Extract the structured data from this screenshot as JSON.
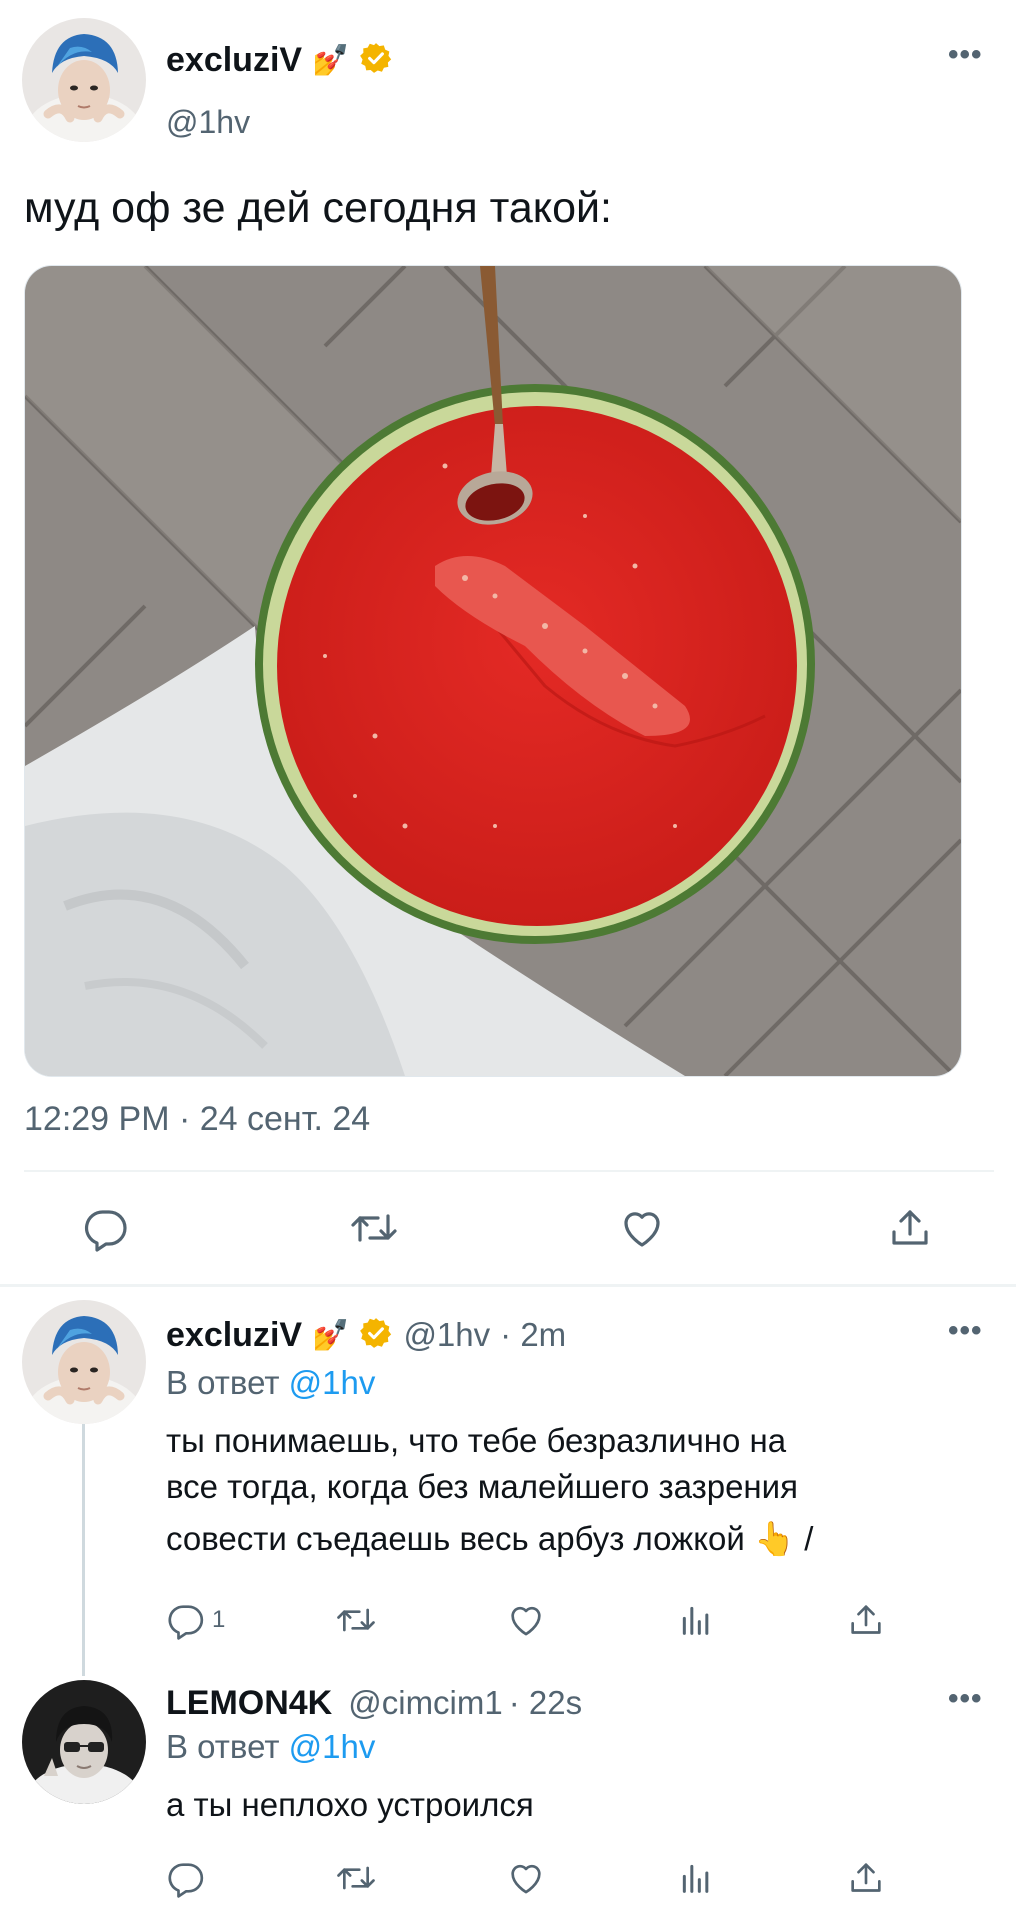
{
  "main_tweet": {
    "author_name": "excluziV",
    "author_emoji": "💅",
    "handle": "@1hv",
    "text": "муд оф зе дей сегодня такой:",
    "timestamp": "12:29 PM · 24 сент. 24",
    "icons": [
      "reply-icon",
      "retweet-icon",
      "like-icon",
      "share-icon"
    ]
  },
  "replies": [
    {
      "author_name": "excluziV",
      "author_emoji": "💅",
      "handle": "@1hv",
      "time": "· 2m",
      "reply_prefix": "В ответ",
      "reply_to": "@1hv",
      "text_line1": "ты понимаешь, что тебе безразлично на",
      "text_line2": "все тогда, когда без малейшего зазрения",
      "text_line3": "совести съедаешь весь арбуз ложкой 👆 /",
      "reply_count": "1"
    },
    {
      "author_name": "LEMON4K",
      "handle": "@cimcim1",
      "time": "· 22s",
      "reply_prefix": "В ответ",
      "reply_to": "@1hv",
      "text_line1": "а ты неплохо устроился",
      "reply_count": ""
    }
  ],
  "colors": {
    "accent": "#1d9bf0",
    "verified": "#f4b400",
    "muted": "#536471",
    "watermelon": "#d9251f",
    "rind": "#5c8a3a"
  }
}
